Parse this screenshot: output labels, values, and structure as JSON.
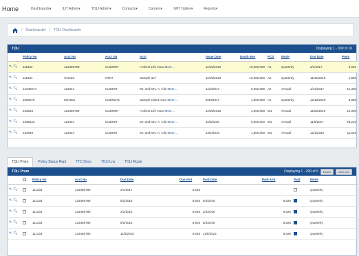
{
  "nav": {
    "brand": "Home",
    "items": [
      "Dashboards▾",
      "ILIT Admin▾",
      "TOLI Admin▾",
      "Contacts▾",
      "Carriers▾",
      "IMIT Tables▾",
      "Reports▾"
    ]
  },
  "breadcrumb": {
    "items": [
      "Dashboards▾",
      "TOLI Dashboard▾"
    ]
  },
  "toli": {
    "title": "TOLI",
    "displaying": "Displaying 1 - 300 of 10",
    "columns": [
      "",
      "Policy No",
      "Acct No",
      "Acct SN",
      "Acct",
      "Issue Date",
      "Death Ben",
      "PCD",
      "Mode",
      "Due Date",
      "Prem"
    ],
    "rows": [
      [
        "111333",
        "123456789",
        "CLIEMRT",
        "A Client Life Insur",
        "More ...",
        "11/15/2016",
        "10,000,000",
        "A1",
        "Quarterly",
        "2/1/2017",
        "6,625"
      ],
      [
        "111334",
        "XVIJD1",
        "IVDIT",
        "Sample ILIT",
        "",
        "11/15/2016",
        "10,000,000",
        "A2",
        "Quarterly",
        "11/15/2016",
        "1,550"
      ],
      [
        "1234567A",
        "123444",
        "CLIEMIT",
        "Mr. and Mrs. A. Clie",
        "More ...",
        "1/14/2017",
        "6,062,065",
        "A2",
        "Annual",
        "1/14/2017",
        "12,330"
      ],
      [
        "1008076",
        "90/1001",
        "CLIEMLT1",
        "Sample Client Insur",
        "More ...",
        "6/30/2017",
        "1,000,000",
        "A1",
        "Quarterly",
        "12/15/2019",
        "5,890"
      ],
      [
        "233534",
        "123456789",
        "CLIEMRT",
        "A Client Life Insur",
        "More ...",
        "11/05/2016",
        "1,000,000",
        "W1",
        "Annual",
        "11/05/2016",
        "10,000"
      ],
      [
        "2468123",
        "123444",
        "CLIEMIT",
        "Mr. and Mrs. A. Clie",
        "More ...",
        "11/5/2016",
        "6,000,000",
        "W2",
        "Annual",
        "11/5/2017",
        "95,216"
      ],
      [
        "233949",
        "123444",
        "CLIEMIT",
        "Mr. and Mrs. A. Clie",
        "More ...",
        "12/1/2016",
        "1,600,000",
        "W2",
        "Annual",
        "12/1/2016",
        "11,549"
      ]
    ]
  },
  "tabs": [
    "TOLI Prem",
    "Policy Status Rept",
    "TTC Docs",
    "TOLI Lns",
    "TOLI Rcpts"
  ],
  "prem": {
    "title": "TOLI Prem",
    "displaying": "Displaying 1 - 200 of 6",
    "delete_label": "Delete",
    "add_label": "Add new",
    "columns": [
      "",
      "",
      "Policy No",
      "Acct No",
      "Due Date",
      "Due Amt",
      "Paid Date",
      "Paid Amt",
      "Paid",
      "Mode"
    ],
    "rows": [
      [
        "111333",
        "123456789",
        "2/1/2017",
        "6,625",
        "",
        "",
        "",
        "Quarterly"
      ],
      [
        "111333",
        "123456789",
        "5/2/2016",
        "6,625",
        "5/2/2016",
        "6,625",
        "on",
        "Quarterly"
      ],
      [
        "111333",
        "123456789",
        "2/2/2016",
        "6,625",
        "2/2/2016",
        "6,625",
        "on",
        "Quarterly"
      ],
      [
        "111333",
        "123456789",
        "8/2/2016",
        "6,625",
        "8/2/2016",
        "6,625",
        "on",
        "Quarterly"
      ],
      [
        "111333",
        "123456789",
        "11/5/2015",
        "6,625",
        "11/5/2015",
        "6,625",
        "on",
        "Quarterly"
      ]
    ]
  }
}
